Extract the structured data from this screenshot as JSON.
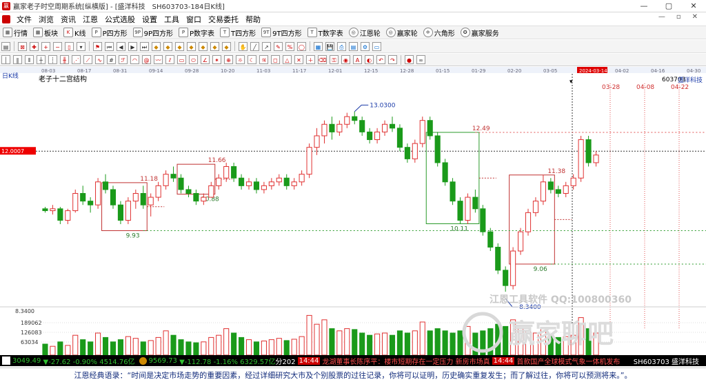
{
  "window": {
    "title": "赢家老子时空周期系统[纵横版] - [盛洋科技　SH603703-184日K线]",
    "min": "—",
    "max": "▢",
    "close": "✕"
  },
  "menu": {
    "items": [
      "文件",
      "浏览",
      "资讯",
      "江恩",
      "公式选股",
      "设置",
      "工具",
      "窗口",
      "交易委托",
      "帮助"
    ],
    "right": [
      "—",
      "▫",
      "✕"
    ]
  },
  "toolbar1": [
    {
      "icon": "grid",
      "label": "行情"
    },
    {
      "icon": "grid",
      "label": "板块"
    },
    {
      "icon": "K",
      "label": "K线"
    },
    {
      "icon": "P",
      "label": "P四方形"
    },
    {
      "icon": "9P",
      "label": "9P四方形"
    },
    {
      "icon": "P",
      "label": "P数字表"
    },
    {
      "icon": "T",
      "label": "T四方形"
    },
    {
      "icon": "9T",
      "label": "9T四方形"
    },
    {
      "icon": "T",
      "label": "T数字表"
    },
    {
      "icon": "◎",
      "label": "江恩轮"
    },
    {
      "icon": "◎",
      "label": "赢家轮"
    },
    {
      "icon": "✡",
      "label": "六角形"
    },
    {
      "icon": "✪",
      "label": "赢家服务"
    }
  ],
  "chart": {
    "period_label": "日K线",
    "indicator_title": "老子十二宫结构",
    "symbol_code": "603703",
    "symbol_name": "盛洋科技",
    "current_price_tag": "12.0007",
    "date_cursor_tag": "2024-03-14",
    "low_axis_label": "8.3400",
    "vol_labels": [
      "189062",
      "126083",
      "63034"
    ],
    "watermark_line": "江恩工具软件  QQ:100800360",
    "watermark_main": "赢家聊吧",
    "date_ticks": [
      "08-03",
      "08-17",
      "08-31",
      "09-14",
      "09-28",
      "10-20",
      "11-03",
      "11-17",
      "12-01",
      "12-15",
      "12-28",
      "01-15",
      "01-29",
      "02-20",
      "03-05",
      "2024-03-14",
      "04-02",
      "04-16",
      "04-30"
    ],
    "future_dates": [
      "03-28",
      "04-08",
      "04-22"
    ],
    "box_labels": [
      "11.18",
      "9.93",
      "11.66",
      "10.88",
      "12.49",
      "10.11",
      "11.38",
      "9.06",
      "13.0300",
      "8.3400"
    ]
  },
  "statusbar": {
    "index1": "3049.49",
    "index1_chg": "▼-27.62 -0.90% 4514.76亿",
    "index2": "9569.73",
    "index2_chg": "▼-112.78 -1.16% 6329.57亿",
    "fen": "分202",
    "time1": "14:44",
    "news1": "龙湖董事长陈序平：楼市短期存在一定压力 新房市场真",
    "time2": "14:44",
    "news2": "首款国产全球模式气象一体机发布",
    "right_code": "SH603703 盛洋科技"
  },
  "quote": {
    "text": "江恩经典语录：“时间是决定市场走势的重要因素，经过详细研究大市及个别股票的过往记录，你将可以证明，历史确实重复发生；而了解过往，你将可以预测将来。”。"
  },
  "chart_data": {
    "type": "candlestick",
    "ylim": [
      8.0,
      13.8
    ],
    "candles": [
      [
        10.5,
        10.55,
        10.4,
        10.45
      ],
      [
        10.45,
        10.6,
        10.35,
        10.5
      ],
      [
        10.5,
        10.55,
        10.1,
        10.2
      ],
      [
        10.2,
        10.5,
        10.1,
        10.45
      ],
      [
        10.45,
        11.0,
        10.4,
        10.9
      ],
      [
        10.9,
        11.1,
        10.6,
        10.7
      ],
      [
        10.7,
        10.8,
        10.4,
        10.6
      ],
      [
        10.6,
        11.3,
        10.5,
        11.2
      ],
      [
        11.2,
        11.4,
        10.9,
        11.0
      ],
      [
        11.0,
        11.1,
        10.5,
        10.6
      ],
      [
        10.6,
        10.7,
        10.1,
        10.2
      ],
      [
        10.2,
        10.8,
        10.1,
        10.7
      ],
      [
        10.7,
        11.0,
        10.5,
        10.9
      ],
      [
        10.9,
        11.1,
        10.5,
        10.6
      ],
      [
        10.6,
        10.9,
        10.3,
        10.8
      ],
      [
        10.8,
        11.2,
        10.7,
        11.1
      ],
      [
        11.1,
        11.5,
        11.0,
        11.4
      ],
      [
        11.4,
        11.6,
        11.2,
        11.3
      ],
      [
        11.3,
        11.4,
        10.9,
        11.0
      ],
      [
        11.0,
        11.1,
        10.8,
        10.9
      ],
      [
        10.9,
        11.0,
        10.6,
        10.7
      ],
      [
        10.7,
        10.9,
        10.6,
        10.8
      ],
      [
        10.8,
        11.2,
        10.8,
        11.1
      ],
      [
        11.1,
        11.4,
        11.0,
        11.3
      ],
      [
        11.3,
        11.7,
        11.2,
        11.6
      ],
      [
        11.6,
        11.7,
        11.2,
        11.3
      ],
      [
        11.3,
        11.4,
        11.0,
        11.1
      ],
      [
        11.1,
        11.3,
        11.0,
        11.2
      ],
      [
        11.2,
        11.3,
        10.9,
        11.0
      ],
      [
        11.0,
        11.2,
        10.9,
        11.1
      ],
      [
        11.1,
        11.3,
        11.0,
        11.2
      ],
      [
        11.2,
        11.4,
        11.1,
        11.3
      ],
      [
        11.3,
        11.4,
        11.0,
        11.1
      ],
      [
        11.1,
        11.3,
        11.0,
        11.2
      ],
      [
        11.2,
        11.5,
        11.1,
        11.4
      ],
      [
        11.4,
        12.2,
        11.3,
        12.1
      ],
      [
        12.1,
        12.6,
        11.9,
        12.4
      ],
      [
        12.4,
        12.8,
        12.2,
        12.7
      ],
      [
        12.7,
        12.9,
        12.3,
        12.5
      ],
      [
        12.5,
        12.8,
        12.4,
        12.7
      ],
      [
        12.7,
        13.0,
        12.6,
        12.9
      ],
      [
        12.9,
        13.03,
        12.7,
        12.8
      ],
      [
        12.8,
        12.9,
        12.4,
        12.5
      ],
      [
        12.5,
        12.6,
        12.2,
        12.3
      ],
      [
        12.3,
        12.6,
        12.2,
        12.5
      ],
      [
        12.5,
        12.8,
        12.4,
        12.7
      ],
      [
        12.7,
        12.9,
        12.5,
        12.6
      ],
      [
        12.6,
        12.7,
        12.0,
        12.1
      ],
      [
        12.1,
        12.2,
        11.7,
        11.8
      ],
      [
        11.8,
        12.3,
        11.7,
        12.2
      ],
      [
        12.2,
        12.9,
        12.1,
        12.8
      ],
      [
        12.8,
        12.9,
        12.3,
        12.4
      ],
      [
        12.4,
        12.5,
        11.6,
        11.7
      ],
      [
        11.7,
        11.8,
        11.1,
        11.2
      ],
      [
        11.2,
        11.3,
        10.6,
        10.7
      ],
      [
        10.7,
        10.8,
        10.1,
        10.2
      ],
      [
        10.2,
        10.9,
        10.1,
        10.8
      ],
      [
        10.8,
        11.0,
        10.4,
        10.5
      ],
      [
        10.5,
        10.6,
        9.8,
        9.9
      ],
      [
        9.9,
        10.0,
        9.4,
        9.5
      ],
      [
        9.5,
        9.6,
        8.8,
        8.9
      ],
      [
        8.9,
        9.0,
        8.34,
        8.5
      ],
      [
        8.5,
        9.5,
        8.4,
        9.4
      ],
      [
        9.4,
        10.0,
        9.3,
        9.9
      ],
      [
        9.9,
        10.5,
        9.8,
        10.4
      ],
      [
        10.4,
        10.8,
        10.3,
        10.7
      ],
      [
        10.7,
        11.38,
        10.6,
        11.2
      ],
      [
        11.2,
        11.3,
        10.9,
        11.0
      ],
      [
        11.0,
        11.1,
        10.8,
        10.9
      ],
      [
        10.9,
        11.2,
        10.8,
        11.1
      ],
      [
        11.1,
        11.4,
        11.0,
        11.3
      ],
      [
        11.3,
        12.4,
        11.2,
        12.3
      ],
      [
        12.3,
        12.4,
        11.6,
        11.7
      ],
      [
        11.7,
        12.0,
        11.6,
        11.9
      ]
    ],
    "volumes": [
      0.25,
      0.2,
      0.3,
      0.22,
      0.45,
      0.35,
      0.3,
      0.5,
      0.4,
      0.3,
      0.35,
      0.42,
      0.38,
      0.3,
      0.33,
      0.4,
      0.55,
      0.45,
      0.35,
      0.3,
      0.28,
      0.3,
      0.4,
      0.45,
      0.6,
      0.5,
      0.4,
      0.35,
      0.3,
      0.32,
      0.35,
      0.38,
      0.33,
      0.36,
      0.42,
      0.9,
      0.7,
      0.8,
      0.6,
      0.55,
      0.6,
      0.58,
      0.5,
      0.45,
      0.48,
      0.5,
      0.45,
      0.55,
      0.5,
      0.55,
      0.75,
      0.55,
      0.6,
      0.55,
      0.5,
      0.55,
      0.65,
      0.5,
      0.55,
      0.6,
      0.7,
      0.65,
      0.8,
      0.6,
      0.55,
      0.5,
      0.6,
      0.45,
      0.4,
      0.42,
      0.45,
      0.85,
      0.6,
      0.5
    ]
  }
}
